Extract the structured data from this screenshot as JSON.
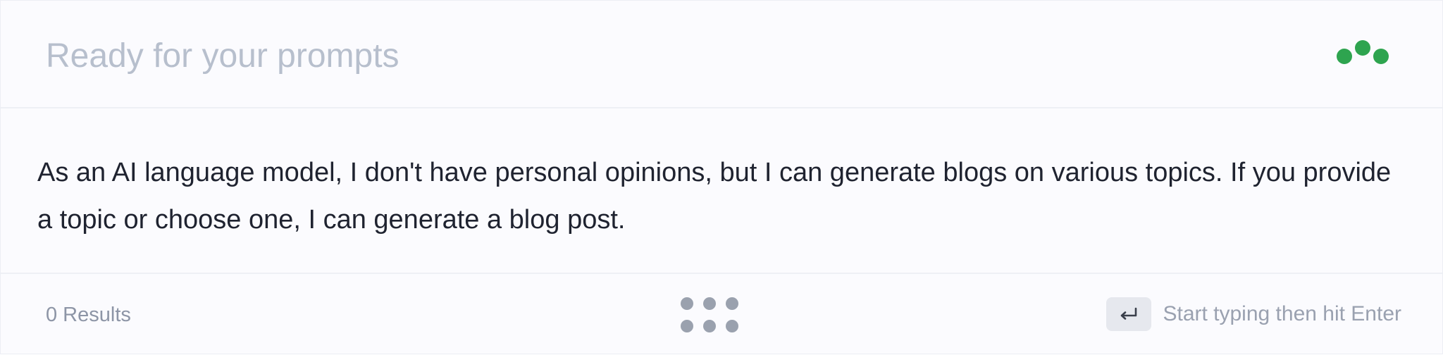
{
  "prompt": {
    "placeholder": "Ready for your prompts"
  },
  "status": {
    "icon": "loading-dots-icon",
    "color": "#2ea44f"
  },
  "response": {
    "text": "As an AI language model, I don't have personal opinions, but I can generate blogs on various topics. If you provide a topic or choose one, I can generate a blog post."
  },
  "footer": {
    "results_label": "0 Results",
    "menu_icon": "grid-dots-icon",
    "enter_icon": "enter-key-icon",
    "hint_label": "Start typing then hit Enter"
  }
}
